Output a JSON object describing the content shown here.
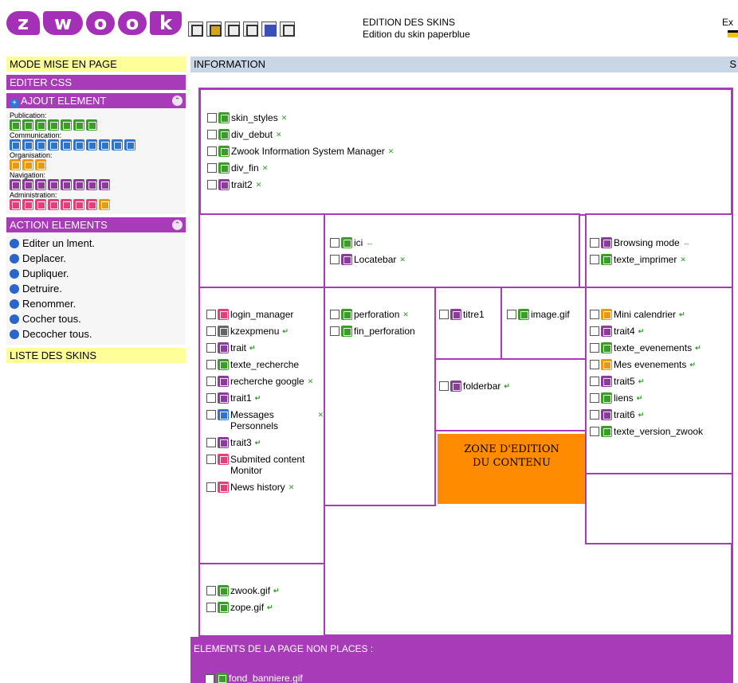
{
  "header": {
    "logo_text": "zwook",
    "logo_letters": [
      "z",
      "w",
      "o",
      "o",
      "k"
    ],
    "title": "EDITION DES SKINS",
    "subtitle": "Edition du skin paperblue",
    "exit_label": "Ex",
    "tool_icons": [
      "bold-text-icon",
      "panel-icon",
      "form-icon",
      "help-icon",
      "layers-icon",
      "z-icon"
    ]
  },
  "sidebar": {
    "mode_mise_en_page": "MODE MISE EN PAGE",
    "editer_css": "EDITER CSS",
    "ajout_element": "AJOUT ELEMENT",
    "collapse_symbol": "⌃",
    "categories": [
      {
        "label": "Publication:",
        "count": 7,
        "color": "#3d9b2a"
      },
      {
        "label": "Communication:",
        "count": 10,
        "color": "#2f74c8"
      },
      {
        "label": "Organisation:",
        "count": 3,
        "color": "#e59a17"
      },
      {
        "label": "Navigation:",
        "count": 8,
        "color": "#8a3c9b"
      },
      {
        "label": "Administration:",
        "count": 8,
        "color": "#e0417a"
      }
    ],
    "action_elements": "ACTION ELEMENTS",
    "actions": [
      "Editer un lment.",
      "Deplacer.",
      "Dupliquer.",
      "Detruire.",
      "Renommer.",
      "Cocher tous.",
      "Decocher tous."
    ],
    "liste_des_skins": "LISTE DES SKINS"
  },
  "info_bar": {
    "label": "INFORMATION",
    "end": "S"
  },
  "cells": {
    "top": [
      "skin_styles",
      "div_debut",
      "Zwook Information System Manager",
      "div_fin",
      "trait2"
    ],
    "nav_mid": [
      "ici",
      "Locatebar"
    ],
    "right_top": [
      "Browsing mode",
      "texte_imprimer"
    ],
    "left_col": [
      "login_manager",
      "kzexpmenu",
      "trait",
      "texte_recherche",
      "recherche google",
      "trait1",
      "Messages Personnels",
      "trait3",
      "Submited content Monitor",
      "News history"
    ],
    "perforation": [
      "perforation",
      "fin_perforation"
    ],
    "titre": "titre1",
    "image": "image.gif",
    "folderbar": "folderbar",
    "zone": "ZONE D'EDITION DU CONTENU",
    "right_col": [
      "Mini calendrier",
      "trait4",
      "texte_evenements",
      "Mes evenements",
      "trait5",
      "liens",
      "trait6",
      "texte_version_zwook"
    ],
    "bottom_left": [
      "zwook.gif",
      "zope.gif"
    ]
  },
  "unplaced": {
    "label": "ELEMENTS DE LA PAGE NON PLACES :",
    "items": [
      "fond_banniere.gif"
    ]
  },
  "colors": {
    "brand": "#a83cb8",
    "zone": "#ff8c00",
    "yellow_bar": "#ffff99",
    "info_bar": "#c9d6e6"
  }
}
